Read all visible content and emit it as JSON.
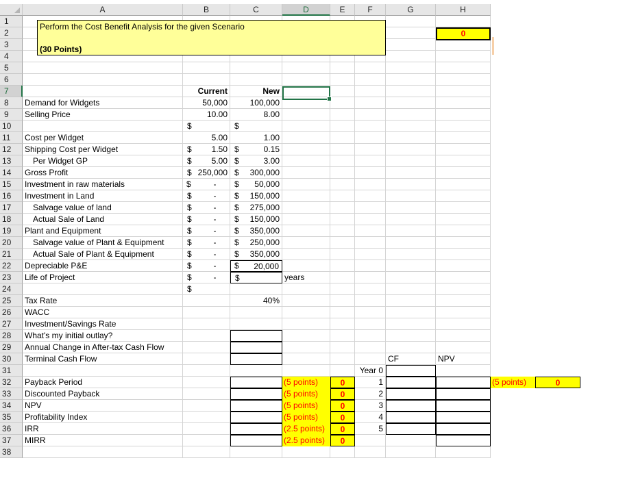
{
  "columns": [
    "A",
    "B",
    "C",
    "D",
    "E",
    "F",
    "G",
    "H"
  ],
  "selected_column": "D",
  "rows": [
    "1",
    "2",
    "3",
    "4",
    "5",
    "6",
    "7",
    "8",
    "9",
    "10",
    "11",
    "12",
    "13",
    "14",
    "15",
    "16",
    "17",
    "18",
    "19",
    "20",
    "21",
    "22",
    "23",
    "24",
    "25",
    "26",
    "27",
    "28",
    "29",
    "30",
    "31",
    "32",
    "33",
    "34",
    "35",
    "36",
    "37",
    "38"
  ],
  "selected_row": "7",
  "title": {
    "line1": "Perform the Cost Benefit Analysis for the given Scenario",
    "line2": "(30 Points)"
  },
  "total_score": "0",
  "headers": {
    "current": "Current",
    "new": "New"
  },
  "inputs": [
    {
      "row": "8",
      "label": "Demand for Widgets",
      "indent": false,
      "current_dollar": "",
      "current": "50,000",
      "new_dollar": "",
      "new": "100,000"
    },
    {
      "row": "9",
      "label": "Selling Price",
      "indent": false,
      "current_dollar": "$",
      "current": "10.00",
      "new_dollar": "$",
      "new": "8.00"
    },
    {
      "row": "11",
      "label": "Cost per Widget",
      "indent": false,
      "current_dollar": "$",
      "current": "5.00",
      "new_dollar": "$",
      "new": "1.00"
    },
    {
      "row": "12",
      "label": "Shipping Cost per Widget",
      "indent": false,
      "current_dollar": "$",
      "current": "1.50",
      "new_dollar": "$",
      "new": "0.15"
    },
    {
      "row": "13",
      "label": "Per Widget GP",
      "indent": true,
      "current_dollar": "$",
      "current": "5.00",
      "new_dollar": "$",
      "new": "3.00"
    },
    {
      "row": "14",
      "label": "Gross Profit",
      "indent": false,
      "current_dollar": "$",
      "current": "250,000",
      "new_dollar": "$",
      "new": "300,000"
    },
    {
      "row": "15",
      "label": "Investment in raw materials",
      "indent": false,
      "current_dollar": "$",
      "current": "-",
      "new_dollar": "$",
      "new": "50,000"
    },
    {
      "row": "16",
      "label": "Investment in Land",
      "indent": false,
      "current_dollar": "$",
      "current": "-",
      "new_dollar": "$",
      "new": "150,000"
    },
    {
      "row": "17",
      "label": "Salvage value of land",
      "indent": true,
      "current_dollar": "$",
      "current": "-",
      "new_dollar": "$",
      "new": "275,000"
    },
    {
      "row": "18",
      "label": "Actual Sale of Land",
      "indent": true,
      "current_dollar": "$",
      "current": "-",
      "new_dollar": "$",
      "new": "150,000"
    },
    {
      "row": "19",
      "label": "Plant and Equipment",
      "indent": false,
      "current_dollar": "$",
      "current": "-",
      "new_dollar": "$",
      "new": "350,000"
    },
    {
      "row": "20",
      "label": "Salvage value of Plant & Equipment",
      "indent": true,
      "current_dollar": "$",
      "current": "-",
      "new_dollar": "$",
      "new": "250,000"
    },
    {
      "row": "21",
      "label": "Actual Sale of Plant & Equipment",
      "indent": true,
      "current_dollar": "$",
      "current": "-",
      "new_dollar": "$",
      "new": "350,000"
    },
    {
      "row": "22",
      "label": "Depreciable P&E",
      "indent": false,
      "current_dollar": "$",
      "current": "-",
      "new_dollar": "$",
      "new": "20,000"
    },
    {
      "row": "23",
      "label": "Life of Project",
      "indent": false,
      "current_dollar": "$",
      "current": "-",
      "new_dollar": "",
      "new": ""
    }
  ],
  "years_label": "years",
  "rates": [
    {
      "row": "25",
      "label": "Tax Rate",
      "value": "40%"
    },
    {
      "row": "26",
      "label": "WACC",
      "value": ""
    },
    {
      "row": "27",
      "label": "Investment/Savings Rate",
      "value": ""
    }
  ],
  "cashflows": [
    {
      "row": "28",
      "label": "What's my initial outlay?",
      "value": ""
    },
    {
      "row": "29",
      "label": "Annual Change in After-tax Cash Flow",
      "value": ""
    },
    {
      "row": "30",
      "label": "Terminal Cash Flow",
      "value": ""
    }
  ],
  "metrics": [
    {
      "row": "32",
      "label": "Payback Period",
      "value": "",
      "points": "(5 points)",
      "score": "0"
    },
    {
      "row": "33",
      "label": "Discounted Payback",
      "value": "",
      "points": "(5 points)",
      "score": "0"
    },
    {
      "row": "34",
      "label": "NPV",
      "value": "",
      "points": "(5 points)",
      "score": "0"
    },
    {
      "row": "35",
      "label": "Profitability Index",
      "value": "",
      "points": "(5 points)",
      "score": "0"
    },
    {
      "row": "36",
      "label": "IRR",
      "value": "",
      "points": "(2.5 points)",
      "score": "0"
    },
    {
      "row": "37",
      "label": "MIRR",
      "value": "",
      "points": "(2.5 points)",
      "score": "0"
    }
  ],
  "cf_table": {
    "cf_header": "CF",
    "npv_header": "NPV",
    "years": [
      "Year 0",
      "1",
      "2",
      "3",
      "4",
      "5"
    ],
    "cf_values": [
      "",
      "",
      "",
      "",
      "",
      ""
    ],
    "npv_values": [
      "",
      "",
      "",
      "",
      "",
      ""
    ],
    "points": "(5 points)",
    "score": "0"
  }
}
